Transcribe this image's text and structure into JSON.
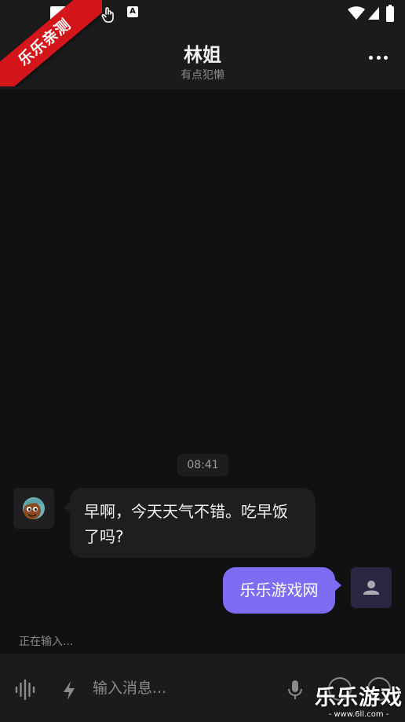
{
  "watermark": {
    "ribbon": "乐乐亲测",
    "brand": "乐乐游戏",
    "site": "www.6ll.com"
  },
  "status_bar": {
    "icons": [
      "image-icon",
      "image-icon",
      "touch-icon",
      "font-icon",
      "wifi-icon",
      "signal-icon",
      "battery-icon"
    ]
  },
  "header": {
    "title": "林姐",
    "subtitle": "有点犯懒"
  },
  "chat": {
    "timestamp": "08:41",
    "messages": [
      {
        "side": "left",
        "text": "早啊，今天天气不错。吃早饭了吗?"
      },
      {
        "side": "right",
        "text": "乐乐游戏网"
      }
    ],
    "typing_status": "正在输入..."
  },
  "input_bar": {
    "placeholder": "输入消息..."
  },
  "colors": {
    "background": "#111112",
    "bar": "#1b1b1c",
    "bubble_in": "#1e1e20",
    "bubble_out": "#7c6df2",
    "ribbon": "#d4161b"
  }
}
